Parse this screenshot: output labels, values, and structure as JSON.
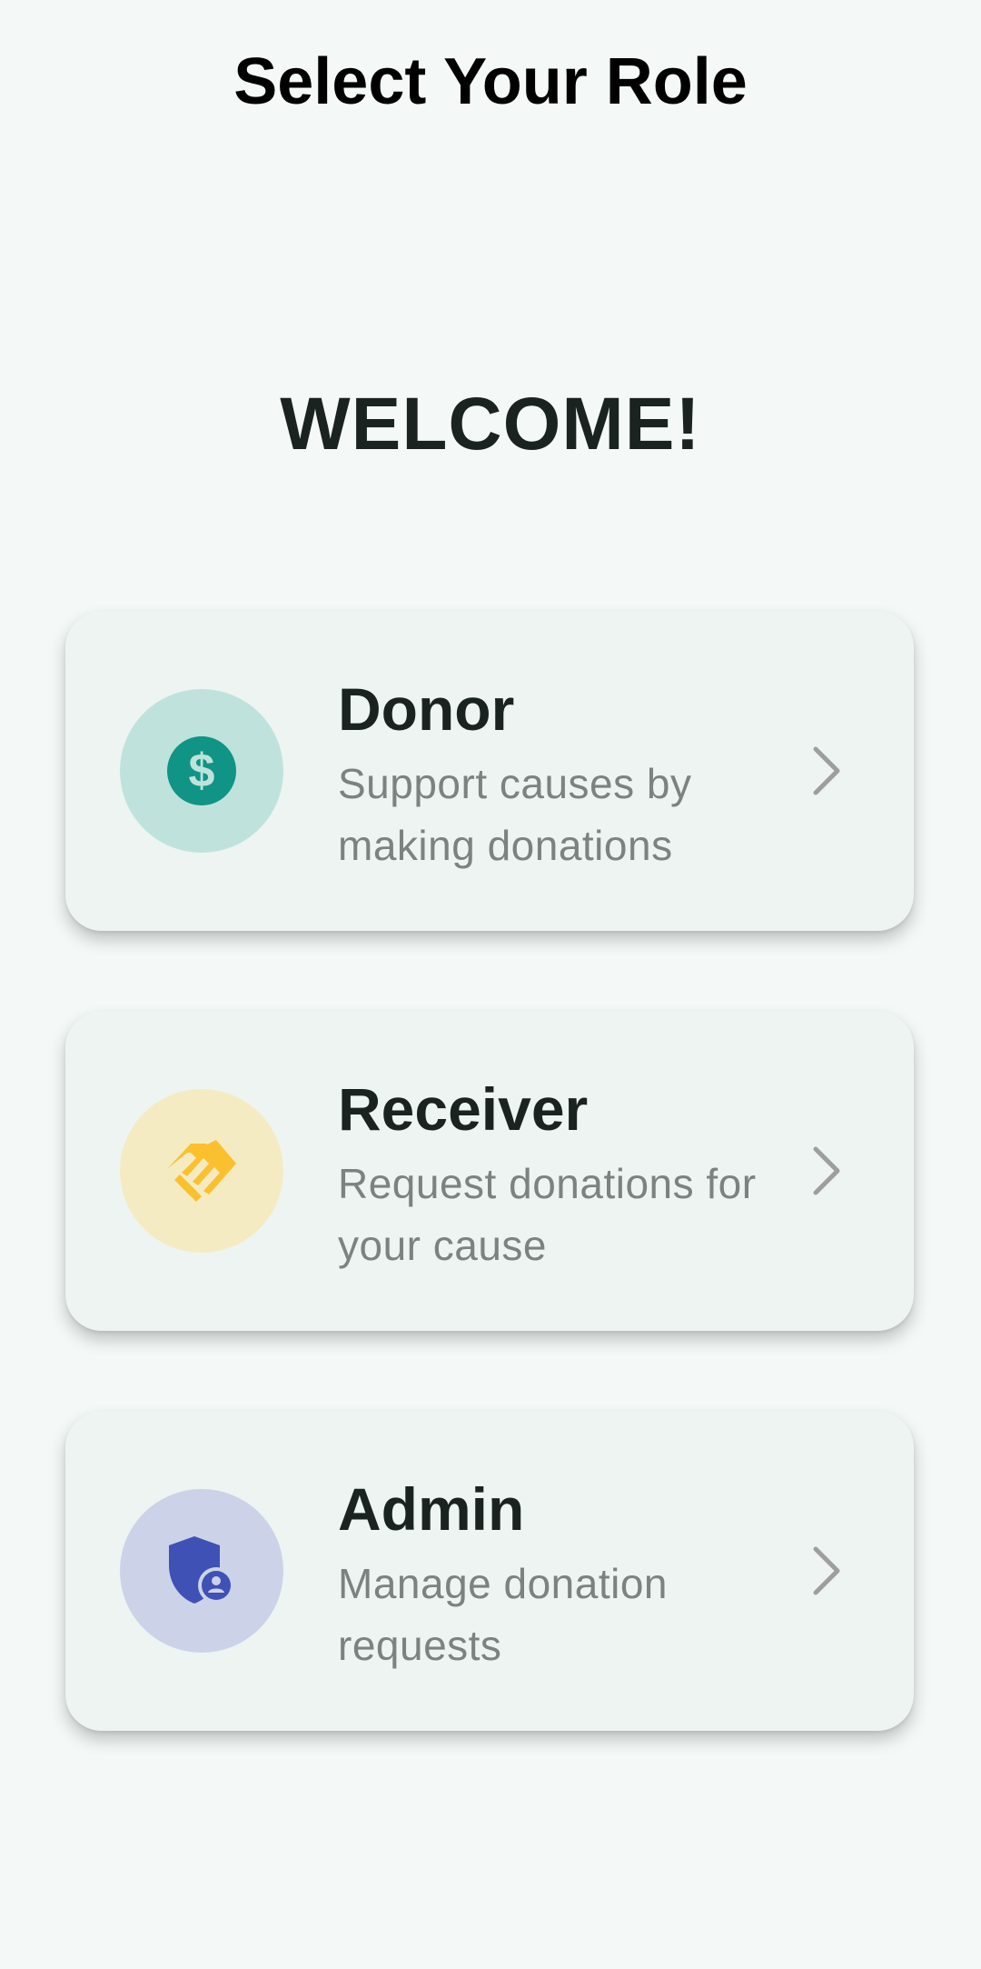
{
  "app_bar": {
    "title": "Select Your Role"
  },
  "welcome": {
    "text": "WELCOME!"
  },
  "roles": [
    {
      "title": "Donor",
      "description": "Support causes by making donations",
      "icon": "dollar-coin-icon",
      "icon_color": "#109485",
      "icon_bg": "#bfe3dc"
    },
    {
      "title": "Receiver",
      "description": "Request donations for your cause",
      "icon": "handshake-icon",
      "icon_color": "#fbc02d",
      "icon_bg": "#f5ebc3"
    },
    {
      "title": "Admin",
      "description": "Manage donation requests",
      "icon": "admin-shield-icon",
      "icon_color": "#3f51b5",
      "icon_bg": "#ccd3e8"
    }
  ],
  "colors": {
    "background": "#f4f9f7",
    "card": "#eef4f2",
    "title_text": "#1b2321",
    "description_text": "#7c8280",
    "chevron": "#9e9e9e"
  }
}
